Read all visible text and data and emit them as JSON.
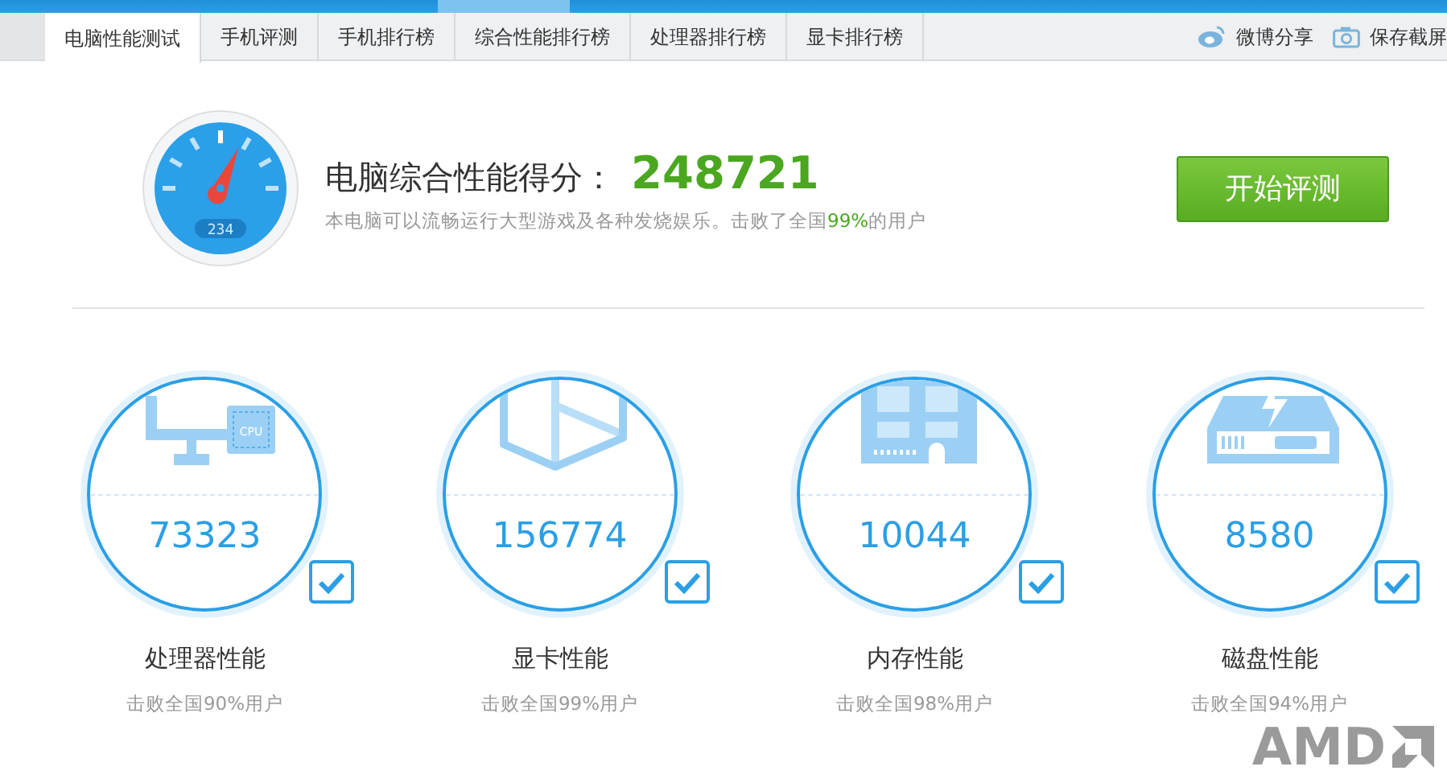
{
  "tabs": [
    {
      "label": "电脑性能测试",
      "selected": true
    },
    {
      "label": "手机评测",
      "selected": false
    },
    {
      "label": "手机排行榜",
      "selected": false
    },
    {
      "label": "综合性能排行榜",
      "selected": false
    },
    {
      "label": "处理器排行榜",
      "selected": false
    },
    {
      "label": "显卡排行榜",
      "selected": false
    }
  ],
  "actions": [
    {
      "kind": "weibo",
      "label": "微博分享"
    },
    {
      "kind": "camera",
      "label": "保存截屏"
    }
  ],
  "score": {
    "gauge_display": "234",
    "title": "电脑综合性能得分：",
    "value": "248721",
    "description_before": "本电脑可以流畅运行大型游戏及各种发烧娱乐。击败了全国",
    "description_highlight": "99%",
    "description_after": "的用户"
  },
  "start_button": "开始评测",
  "components": [
    {
      "kind": "cpu",
      "score": "73323",
      "checked": true,
      "label": "处理器性能",
      "note": "击败全国90%用户",
      "chip_text": "CPU"
    },
    {
      "kind": "gpu",
      "score": "156774",
      "checked": true,
      "label": "显卡性能",
      "note": "击败全国99%用户"
    },
    {
      "kind": "memory",
      "score": "10044",
      "checked": true,
      "label": "内存性能",
      "note": "击败全国98%用户"
    },
    {
      "kind": "disk",
      "score": "8580",
      "checked": true,
      "label": "磁盘性能",
      "note": "击败全国94%用户"
    }
  ],
  "logo": "AMD"
}
